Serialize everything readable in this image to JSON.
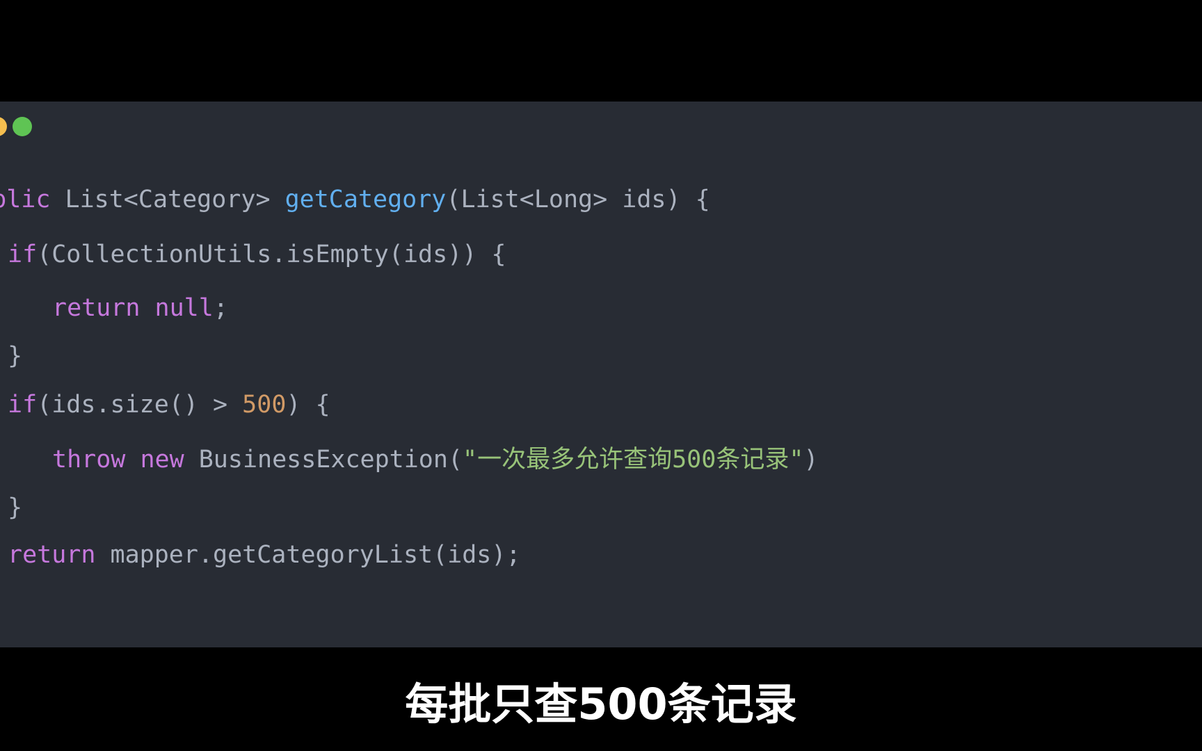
{
  "window": {
    "controls": [
      {
        "name": "minimize",
        "color": "#f5be4f"
      },
      {
        "name": "maximize",
        "color": "#5fc454"
      }
    ]
  },
  "code": {
    "line1": {
      "kw": "public",
      "type": " List<Category> ",
      "fn": "getCategory",
      "rest": "(List<Long> ids) {"
    },
    "line2": {
      "kw": "if",
      "rest": "(CollectionUtils.isEmpty(ids)) {"
    },
    "line3": {
      "kw1": "return",
      "kw2": "null",
      "rest": ";"
    },
    "line4": {
      "rest": "}"
    },
    "line5": {
      "kw": "if",
      "rest": "(ids.size() > ",
      "num": "500",
      "end": ") {"
    },
    "line6": {
      "kw1": "throw",
      "kw2": "new",
      "rest": " BusinessException(",
      "str": "\"一次最多允许查询500条记录\"",
      "end": ")"
    },
    "line7": {
      "rest": "}"
    },
    "line8": {
      "kw": "return",
      "rest": " mapper.getCategoryList(ids);"
    }
  },
  "subtitle": "每批只查500条记录",
  "colors": {
    "background": "#282c34",
    "keyword": "#c678dd",
    "function": "#61afef",
    "number": "#d19a66",
    "string": "#98c379",
    "text": "#abb2bf"
  }
}
